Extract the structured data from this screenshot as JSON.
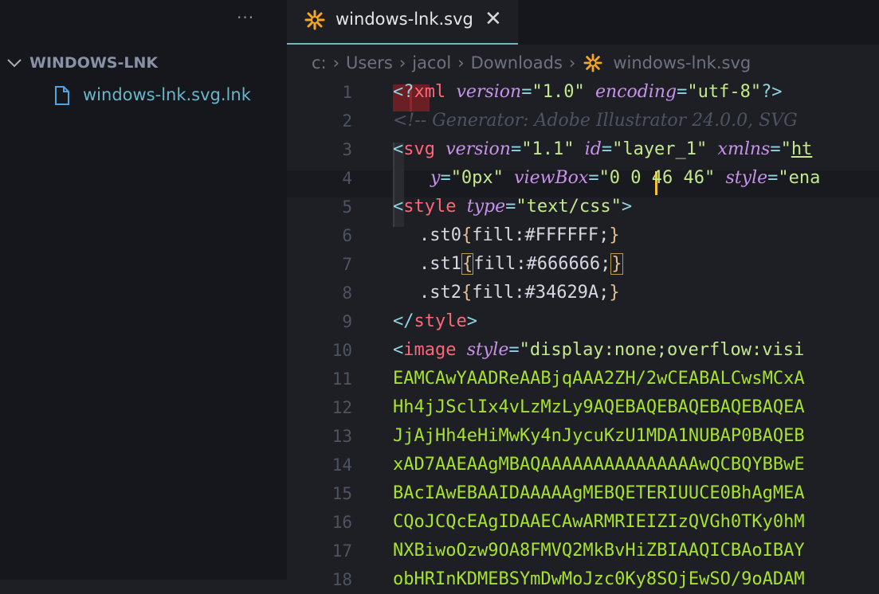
{
  "sidebar": {
    "more_label": "···",
    "folder": {
      "name": "WINDOWS-LNK",
      "icon": "chevron-down-icon"
    },
    "files": [
      {
        "name": "windows-lnk.svg.lnk",
        "icon": "file-icon"
      }
    ]
  },
  "tab": {
    "label": "windows-lnk.svg",
    "close": "✕",
    "icon": "svg-file-icon"
  },
  "breadcrumb": {
    "parts": [
      "c:",
      "Users",
      "jacol",
      "Downloads"
    ],
    "file": "windows-lnk.svg",
    "separator": "›"
  },
  "line_numbers": [
    "1",
    "2",
    "3",
    "4",
    "5",
    "6",
    "7",
    "8",
    "9",
    "10",
    "11",
    "12",
    "13",
    "14",
    "15",
    "16",
    "17",
    "18"
  ],
  "code": {
    "l1": {
      "open": "<?",
      "tag": "xml",
      "a1": "version",
      "eq": "=",
      "v1": "\"1.0\"",
      "a2": "encoding",
      "v2": "\"utf-8\"",
      "close": "?>"
    },
    "l2": {
      "comment": "<!-- Generator: Adobe Illustrator 24.0.0, SVG"
    },
    "l3": {
      "open": "<",
      "tag": "svg",
      "a1": "version",
      "eq": "=",
      "v1": "\"1.1\"",
      "a2": "id",
      "v2": "\"layer_1\"",
      "a3": "xmlns",
      "v3a": "\"",
      "v3b": "ht"
    },
    "l4": {
      "a1": "y",
      "eq": "=",
      "v1": "\"0px\"",
      "a2": "viewBox",
      "v2": "\"0 0 46 46\"",
      "a3": "style",
      "v3": "\"ena"
    },
    "l5": {
      "open": "<",
      "tag": "style",
      "a1": "type",
      "eq": "=",
      "v1": "\"text/css\"",
      "close": ">"
    },
    "l6": {
      "sel": ".st0",
      "ob": "{",
      "body": "fill:#FFFFFF;",
      "cb": "}"
    },
    "l7": {
      "sel": ".st1",
      "ob": "{",
      "body": "fill:#666666;",
      "cb": "}"
    },
    "l8": {
      "sel": ".st2",
      "ob": "{",
      "body": "fill:#34629A;",
      "cb": "}"
    },
    "l9": {
      "open": "</",
      "tag": "style",
      "close": ">"
    },
    "l10": {
      "open": "<",
      "tag": "image",
      "a1": "style",
      "eq": "=",
      "v1": "\"display:none;overflow:visi"
    },
    "l11": "EAMCAwYAADReAABjqAAA2ZH/2wCEABALCwsMCxA",
    "l12": "Hh4jJSclIx4vLzMzLy9AQEBAQEBAQEBAQEBAQEA",
    "l13": "JjAjHh4eHiMwKy4nJycuKzU1MDA1NUBAP0BAQEB",
    "l14": "xAD7AAEAAgMBAQAAAAAAAAAAAAAAAwQCBQYBBwE",
    "l15": "BAcIAwEBAAIDAAAAAgMEBQETERIUUCE0BhAgMEA",
    "l16": "CQoJCQcEAgIDAAECAwARMRIEIZIzQVGh0TKy0hM",
    "l17": "NXBiwoOzw9OA8FMVQ2MkBvHiZBIAAQICBAoIBAY",
    "l18": "obHRInKDMEBSYmDwMoJzc0Ky8SOjEwSO/9oADAM"
  },
  "colors": {
    "accent": "#6fb6c2",
    "tag": "#ff6677",
    "attr": "#c792ea",
    "string": "#c3e88d",
    "base64": "#a6e22e",
    "svg_icon": "#f5a623"
  }
}
